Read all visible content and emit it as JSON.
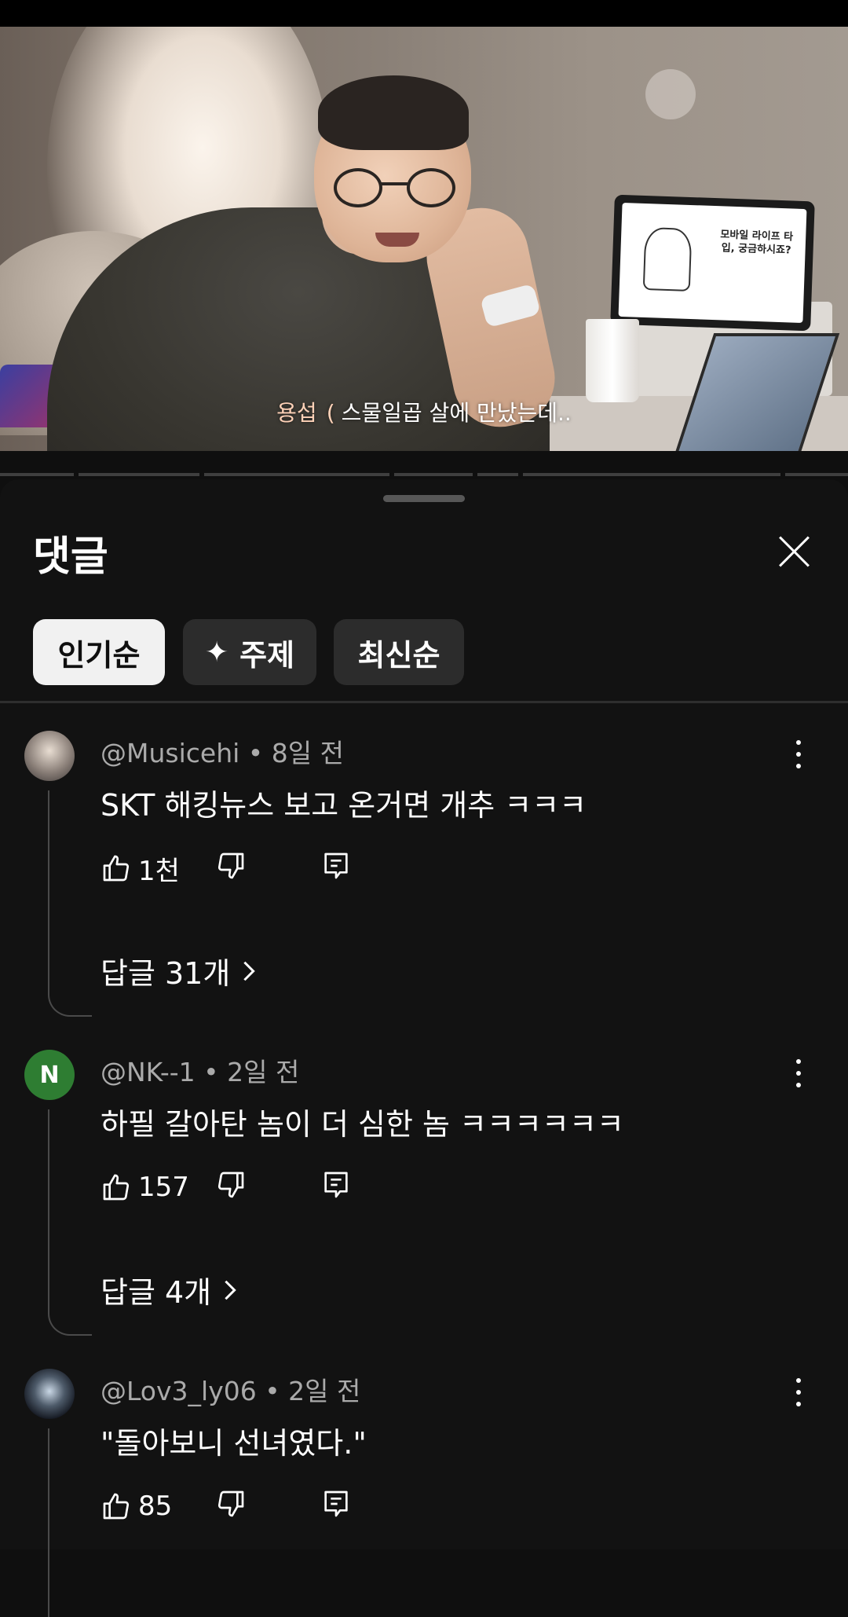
{
  "video": {
    "subtitle_speaker": "용섭",
    "subtitle_text": "스물일곱 살에 만났는데..",
    "tablet_text": "모바일 라이프 타입, 궁금하시죠?"
  },
  "comments_panel": {
    "title": "댓글",
    "filters": [
      {
        "label": "인기순",
        "active": true
      },
      {
        "label": "주제",
        "icon": "sparkle-icon",
        "active": false
      },
      {
        "label": "최신순",
        "active": false
      }
    ]
  },
  "comments": [
    {
      "author": "@Musicehi",
      "time": "8일 전",
      "text": "SKT 해킹뉴스 보고 온거면 개추 ㅋㅋㅋ",
      "likes": "1천",
      "replies_label": "답글 31개",
      "avatar": "photo"
    },
    {
      "author": "@NK--1",
      "time": "2일 전",
      "text": "하필 갈아탄 놈이 더 심한 놈 ㅋㅋㅋㅋㅋㅋ",
      "likes": "157",
      "replies_label": "답글 4개",
      "avatar_letter": "N",
      "avatar_color": "#2e7d32"
    },
    {
      "author": "@Lov3_ly06",
      "time": "2일 전",
      "text": "\"돌아보니 선녀였다.\"",
      "likes": "85",
      "avatar": "photo"
    }
  ]
}
